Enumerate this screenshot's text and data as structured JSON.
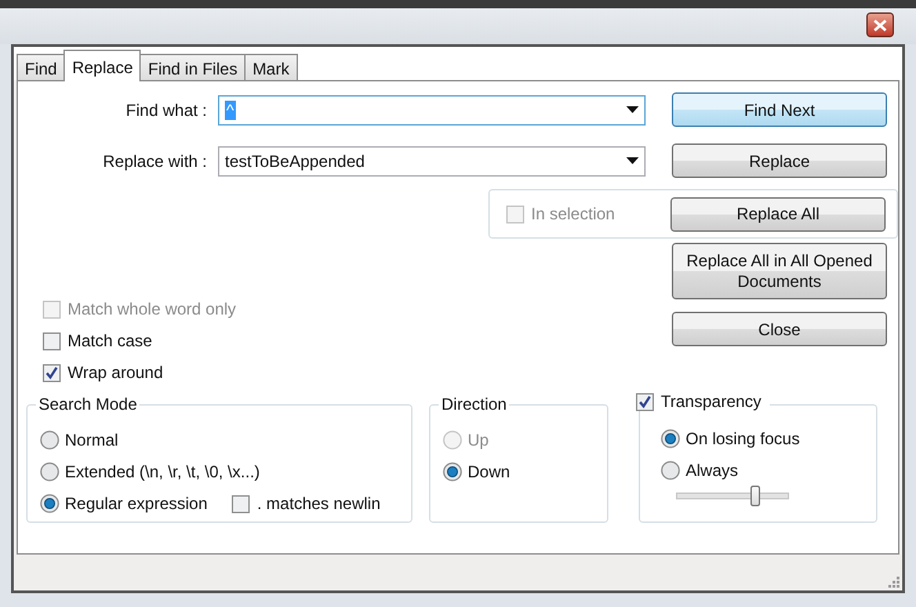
{
  "tabs": [
    {
      "label": "Find",
      "selected": false
    },
    {
      "label": "Replace",
      "selected": true
    },
    {
      "label": "Find in Files",
      "selected": false
    },
    {
      "label": "Mark",
      "selected": false
    }
  ],
  "find_what": {
    "label": "Find what :",
    "value": "^"
  },
  "replace_with": {
    "label": "Replace with :",
    "value": "testToBeAppended"
  },
  "buttons": [
    {
      "label": "Find Next",
      "focused": true
    },
    {
      "label": "Replace",
      "focused": false
    },
    {
      "label": "Replace All",
      "focused": false
    },
    {
      "label": "Replace All in All Opened Documents",
      "focused": false
    },
    {
      "label": "Close",
      "focused": false
    }
  ],
  "in_selection": {
    "label": "In selection",
    "checked": false,
    "disabled": true
  },
  "options": [
    {
      "label": "Match whole word only",
      "checked": false,
      "disabled": true
    },
    {
      "label": "Match case",
      "checked": false,
      "disabled": false
    },
    {
      "label": "Wrap around",
      "checked": true,
      "disabled": false
    }
  ],
  "search_mode": {
    "title": "Search Mode",
    "options": [
      {
        "label": "Normal",
        "selected": false
      },
      {
        "label": "Extended (\\n, \\r, \\t, \\0, \\x...)",
        "selected": false
      },
      {
        "label": "Regular expression",
        "selected": true
      }
    ],
    "dot_matches_newline": {
      "label": ". matches newlin",
      "checked": false
    }
  },
  "direction": {
    "title": "Direction",
    "options": [
      {
        "label": "Up",
        "selected": false,
        "disabled": true
      },
      {
        "label": "Down",
        "selected": true,
        "disabled": false
      }
    ]
  },
  "transparency": {
    "label": "Transparency",
    "checked": true,
    "options": [
      {
        "label": "On losing focus",
        "selected": true
      },
      {
        "label": "Always",
        "selected": false
      }
    ],
    "level": 0.7
  }
}
